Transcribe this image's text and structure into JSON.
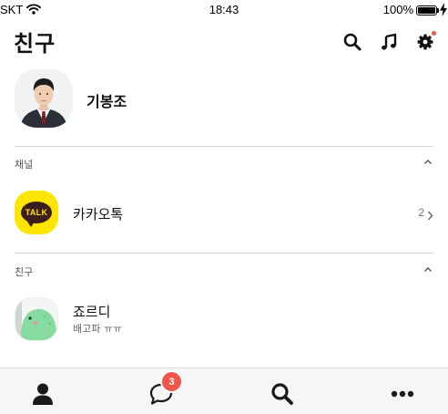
{
  "status_bar": {
    "carrier": "SKT",
    "time": "18:43",
    "battery_percent": "100%",
    "battery_level": 1.0,
    "icons": [
      "wifi-icon",
      "battery-icon",
      "charging-bolt-icon"
    ]
  },
  "header": {
    "title": "친구",
    "icons": [
      "search-icon",
      "music-note-icon",
      "gear-icon"
    ],
    "settings_has_new": true
  },
  "profile": {
    "name": "기봉조"
  },
  "sections": {
    "channels": {
      "label": "채널",
      "items": [
        {
          "title": "카카오톡",
          "count": "2",
          "icon": "kakaotalk-logo",
          "logo_text": "TALK"
        }
      ]
    },
    "friends": {
      "label": "친구",
      "items": [
        {
          "name": "죠르디",
          "status_message": "배고파 ㅠㅠ"
        }
      ]
    }
  },
  "tab_bar": {
    "tabs": [
      "friends-tab",
      "chats-tab",
      "search-tab",
      "more-tab"
    ],
    "chats_badge": "3"
  },
  "colors": {
    "kakao_yellow": "#fee500",
    "kakao_brown": "#3c1e1e",
    "badge_red": "#f2554a",
    "divider": "#d9d9d9"
  }
}
